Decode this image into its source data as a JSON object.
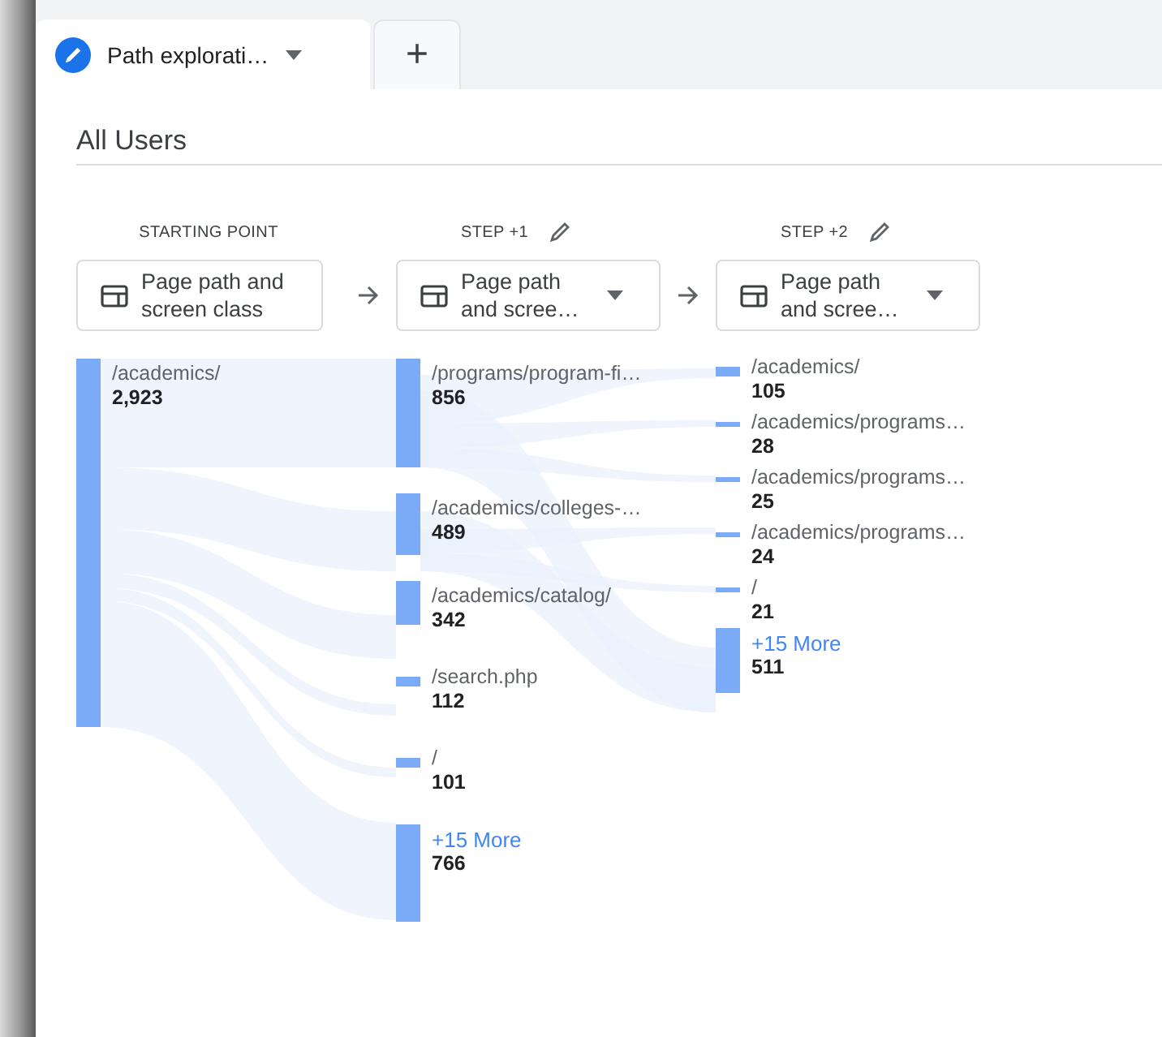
{
  "tabs": [
    {
      "label": "Path explorati…",
      "selected": true
    }
  ],
  "add_tab": "+",
  "segment": "All Users",
  "steps": [
    {
      "heading": "STARTING POINT",
      "editable": false,
      "dimension": "Page path and screen class",
      "has_menu": false,
      "nodes": [
        {
          "kind": "page",
          "label": "/academics/",
          "count": "2,923"
        }
      ]
    },
    {
      "heading": "STEP +1",
      "editable": true,
      "dimension": "Page path and scree…",
      "has_menu": true,
      "nodes": [
        {
          "kind": "page",
          "label": "/programs/program-fi…",
          "count": "856"
        },
        {
          "kind": "page",
          "label": "/academics/colleges-…",
          "count": "489"
        },
        {
          "kind": "page",
          "label": "/academics/catalog/",
          "count": "342"
        },
        {
          "kind": "page",
          "label": "/search.php",
          "count": "112"
        },
        {
          "kind": "page",
          "label": "/",
          "count": "101"
        },
        {
          "kind": "more",
          "label": "+15 More",
          "count": "766"
        }
      ]
    },
    {
      "heading": "STEP +2",
      "editable": true,
      "dimension": "Page path and scree…",
      "has_menu": true,
      "nodes": [
        {
          "kind": "page",
          "label": "/academics/",
          "count": "105"
        },
        {
          "kind": "page",
          "label": "/academics/programs…",
          "count": "28"
        },
        {
          "kind": "page",
          "label": "/academics/programs…",
          "count": "25"
        },
        {
          "kind": "page",
          "label": "/academics/programs…",
          "count": "24"
        },
        {
          "kind": "page",
          "label": "/",
          "count": "21"
        },
        {
          "kind": "more",
          "label": "+15 More",
          "count": "511"
        }
      ]
    }
  ]
}
